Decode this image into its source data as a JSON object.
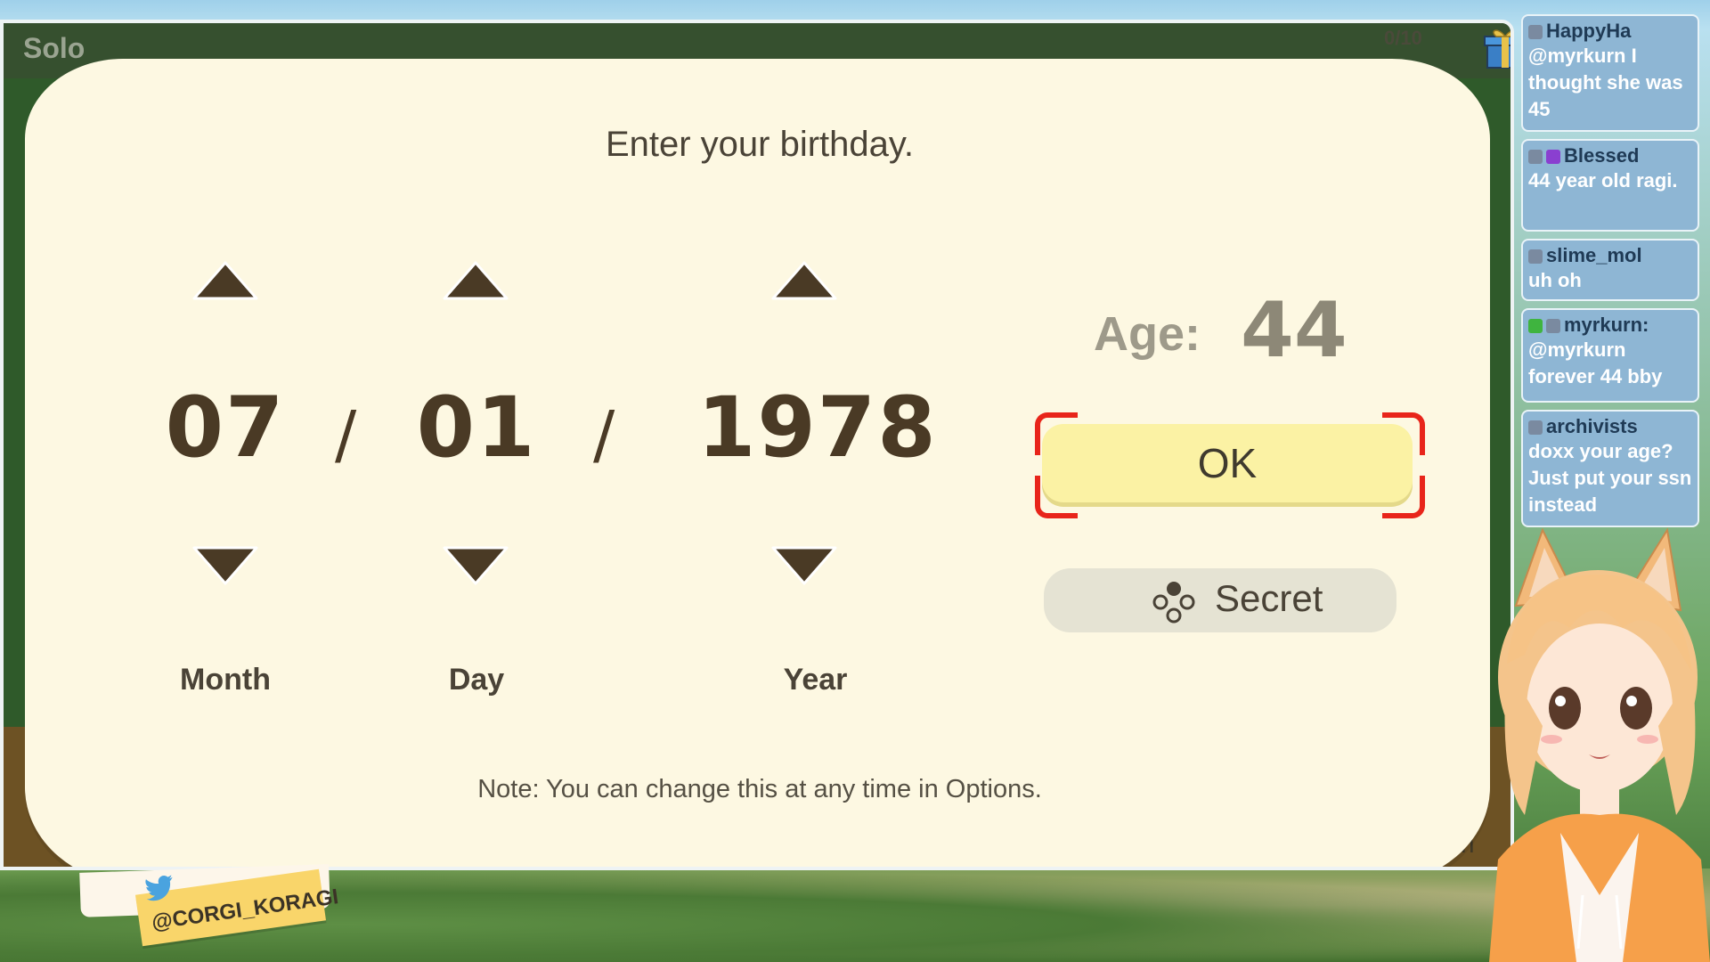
{
  "game": {
    "mode_label": "Solo",
    "counter": "0/10",
    "confirm_hint": "nfirm"
  },
  "dialog": {
    "title": "Enter your birthday.",
    "month": {
      "value": "07",
      "label": "Month"
    },
    "day": {
      "value": "01",
      "label": "Day"
    },
    "year": {
      "value": "1978",
      "label": "Year"
    },
    "separator": "/",
    "age_label": "Age:",
    "age_value": "44",
    "ok_label": "OK",
    "secret_label": "Secret",
    "note": "Note: You can change this at any time in Options."
  },
  "chat": {
    "messages": [
      {
        "user": "HappyHa",
        "text": "@myrkurn I thought she was 45"
      },
      {
        "user": "Blessed",
        "text": "44 year old ragi."
      },
      {
        "user": "slime_mol",
        "text": "uh oh"
      },
      {
        "user": "myrkurn:",
        "text": "@myrkurn forever 44 bby"
      },
      {
        "user": "archivists",
        "text": "doxx your age? Just put your ssn instead"
      }
    ]
  },
  "overlay": {
    "twitter_handle": "@CORGI_KORAGI"
  },
  "colors": {
    "dialog_bg": "#fdf8e2",
    "ok_bg": "#fbf2a4",
    "focus_corner": "#e8251a",
    "text_dark": "#4a3a25"
  },
  "icons": {
    "up": "triangle-up-icon",
    "down": "triangle-down-icon",
    "secret": "three-dot-controller-icon",
    "gift": "gift-box-icon",
    "twitter": "twitter-bird-icon"
  }
}
